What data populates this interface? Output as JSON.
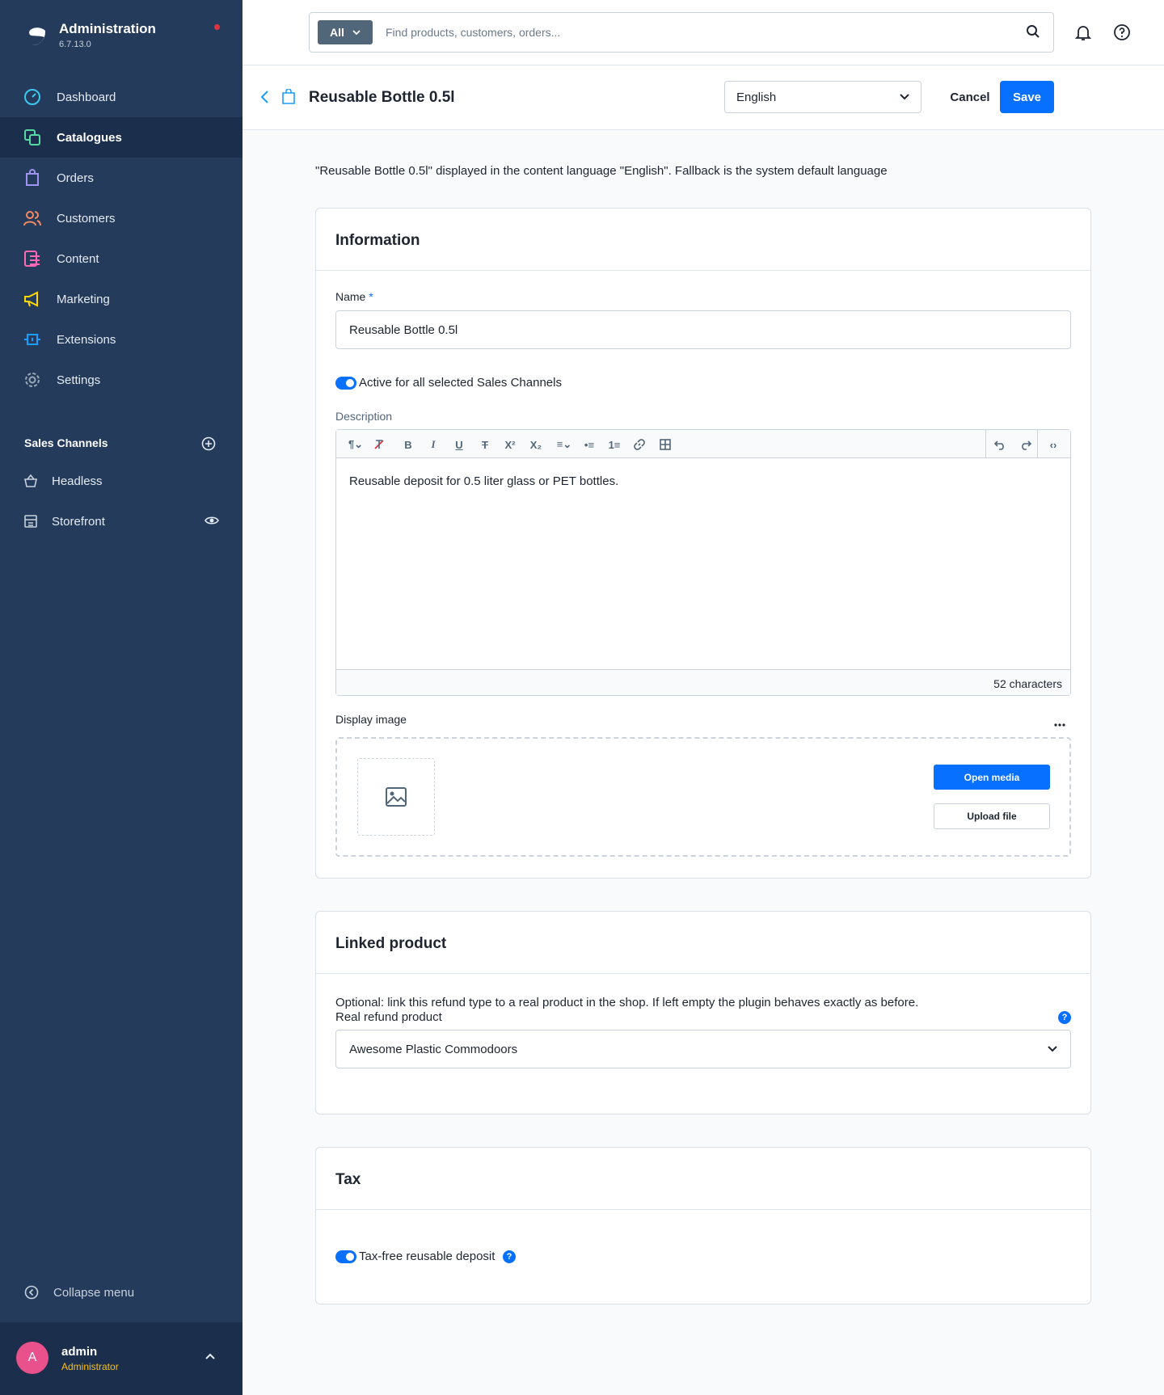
{
  "sidebar": {
    "app_title": "Administration",
    "version": "6.7.13.0",
    "nav": [
      {
        "label": "Dashboard",
        "icon": "dashboard-icon",
        "color": "#3dc8f0"
      },
      {
        "label": "Catalogues",
        "icon": "catalogues-icon",
        "color": "#57d9a3",
        "active": true
      },
      {
        "label": "Orders",
        "icon": "orders-icon",
        "color": "#a092f0"
      },
      {
        "label": "Customers",
        "icon": "customers-icon",
        "color": "#f88962"
      },
      {
        "label": "Content",
        "icon": "content-icon",
        "color": "#ff68b4"
      },
      {
        "label": "Marketing",
        "icon": "marketing-icon",
        "color": "#ffd700"
      },
      {
        "label": "Extensions",
        "icon": "extensions-icon",
        "color": "#189eff"
      },
      {
        "label": "Settings",
        "icon": "settings-icon",
        "color": "#9aa8b5"
      }
    ],
    "sales_channels_title": "Sales Channels",
    "sales_channels": [
      {
        "label": "Headless",
        "icon": "basket-icon"
      },
      {
        "label": "Storefront",
        "icon": "storefront-icon"
      }
    ],
    "collapse_label": "Collapse menu",
    "user": {
      "initial": "A",
      "name": "admin",
      "role": "Administrator"
    }
  },
  "topbar": {
    "search_type": "All",
    "search_placeholder": "Find products, customers, orders..."
  },
  "header": {
    "title": "Reusable Bottle 0.5l",
    "language": "English",
    "cancel_label": "Cancel",
    "save_label": "Save"
  },
  "notice": "\"Reusable Bottle 0.5l\" displayed in the content language \"English\". Fallback is the system default language",
  "information": {
    "title": "Information",
    "name_label": "Name",
    "name_required": "*",
    "name_value": "Reusable Bottle 0.5l",
    "active_label": "Active for all selected Sales Channels",
    "description_label": "Description",
    "description_text": "Reusable deposit for 0.5 liter glass or PET bottles.",
    "char_count": "52 characters",
    "display_image_label": "Display image",
    "open_media_label": "Open media",
    "upload_file_label": "Upload file"
  },
  "linked_product": {
    "title": "Linked product",
    "hint": "Optional: link this refund type to a real product in the shop. If left empty the plugin behaves exactly as before.",
    "field_label": "Real refund product",
    "selected": "Awesome Plastic Commodoors"
  },
  "tax": {
    "title": "Tax",
    "toggle_label": "Tax-free reusable deposit"
  },
  "accent_color": "#0870ff"
}
